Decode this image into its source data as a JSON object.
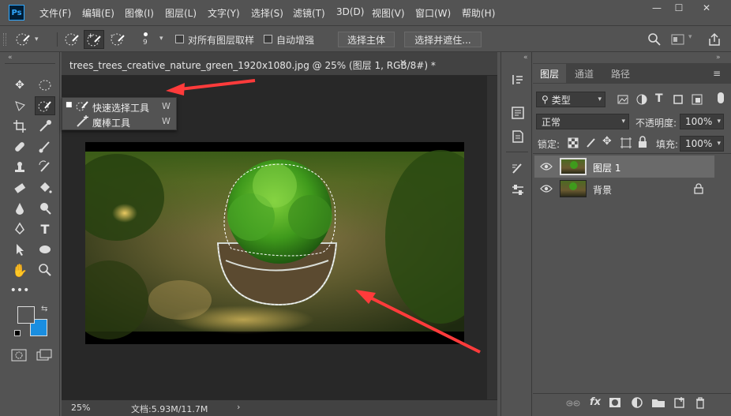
{
  "app": {
    "logo": "Ps"
  },
  "menus": [
    "文件(F)",
    "编辑(E)",
    "图像(I)",
    "图层(L)",
    "文字(Y)",
    "选择(S)",
    "滤镜(T)",
    "3D(D)",
    "视图(V)",
    "窗口(W)",
    "帮助(H)"
  ],
  "window_controls": {
    "minimize": "—",
    "maximize": "☐",
    "close": "✕"
  },
  "options": {
    "brush_size": "9",
    "sample_all_layers": "对所有图层取样",
    "auto_enhance": "自动增强",
    "select_subject": "选择主体",
    "select_and_mask": "选择并遮住..."
  },
  "document": {
    "tab_title": "trees_trees_creative_nature_green_1920x1080.jpg @ 25% (图层 1, RGB/8#) *",
    "zoom": "25%",
    "doc_info": "文档:5.93M/11.7M"
  },
  "tool_flyout": {
    "items": [
      {
        "label": "快速选择工具",
        "shortcut": "W"
      },
      {
        "label": "魔棒工具",
        "shortcut": "W"
      }
    ]
  },
  "layers_panel": {
    "tabs": [
      "图层",
      "通道",
      "路径"
    ],
    "filter": "类型",
    "blend_mode": "正常",
    "opacity_label": "不透明度:",
    "opacity_value": "100%",
    "lock_label": "锁定:",
    "fill_label": "填充:",
    "fill_value": "100%",
    "layers": [
      {
        "name": "图层 1",
        "selected": true
      },
      {
        "name": "背景",
        "locked": true
      }
    ]
  },
  "colors": {
    "foreground": "#555555",
    "background": "#1a8ee0",
    "annotation_arrow": "#ff3b3b"
  }
}
